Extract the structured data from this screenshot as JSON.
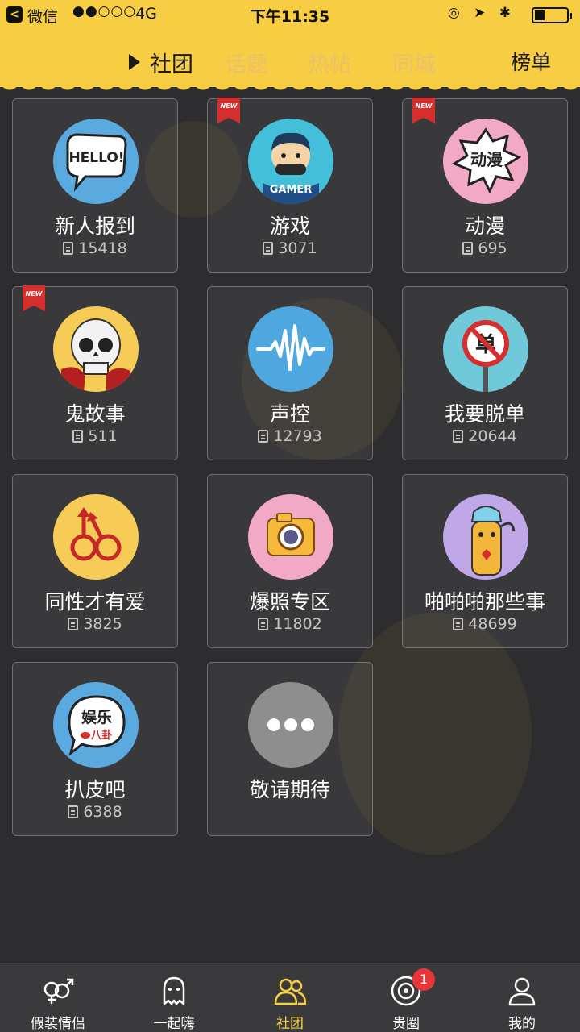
{
  "status_bar": {
    "back_label": "<",
    "carrier": "微信",
    "signal": "●●○○○",
    "network": "4G",
    "time": "下午11:35",
    "right_icons": "◎ ➤ ✱"
  },
  "header": {
    "tabs": [
      {
        "label": "社团",
        "active": true
      },
      {
        "label": "话题",
        "active": false
      },
      {
        "label": "热帖",
        "active": false
      },
      {
        "label": "同城",
        "active": false
      }
    ],
    "rank_label": "榜单"
  },
  "clubs": [
    {
      "name": "新人报到",
      "count": "15418",
      "is_new": false,
      "icon": "hello-speech-bubble-icon",
      "bg": "#5aa9df"
    },
    {
      "name": "游戏",
      "count": "3071",
      "is_new": true,
      "new_label": "NEW",
      "icon": "gamer-controller-icon",
      "bg": "#44bfd9"
    },
    {
      "name": "动漫",
      "count": "695",
      "is_new": true,
      "new_label": "NEW",
      "icon": "comic-burst-icon",
      "bg": "#f2a9c6"
    },
    {
      "name": "鬼故事",
      "count": "511",
      "is_new": true,
      "new_label": "NEW",
      "icon": "skull-icon",
      "bg": "#f6cc56"
    },
    {
      "name": "声控",
      "count": "12793",
      "is_new": false,
      "icon": "sound-wave-icon",
      "bg": "#4fa7df"
    },
    {
      "name": "我要脱单",
      "count": "20644",
      "is_new": false,
      "icon": "no-single-sign-icon",
      "bg": "#6fc9d8"
    },
    {
      "name": "同性才有爱",
      "count": "3825",
      "is_new": false,
      "icon": "male-symbols-icon",
      "bg": "#f6cc56"
    },
    {
      "name": "爆照专区",
      "count": "11802",
      "is_new": false,
      "icon": "camera-icon",
      "bg": "#f2a9c6"
    },
    {
      "name": "啪啪啪那些事",
      "count": "48699",
      "is_new": false,
      "icon": "cartoon-character-icon",
      "bg": "#c0a8e8"
    },
    {
      "name": "扒皮吧",
      "count": "6388",
      "is_new": false,
      "icon": "gossip-bubble-icon",
      "bg": "#5aa9df"
    },
    {
      "name": "敬请期待",
      "count": "",
      "is_new": false,
      "icon": "more-dots-icon",
      "bg": "#8e8e8e"
    }
  ],
  "club_art_text": {
    "hello": "HELLO!",
    "gamer": "GAMER",
    "comic": "动漫",
    "no_single": "单",
    "gossip_main": "娱乐",
    "gossip_sub": "八卦"
  },
  "tabbar": {
    "items": [
      {
        "label": "假装情侣",
        "icon": "gender-couple-icon",
        "active": false
      },
      {
        "label": "一起嗨",
        "icon": "ghost-icon",
        "active": false
      },
      {
        "label": "社团",
        "icon": "group-people-icon",
        "active": true
      },
      {
        "label": "贵圈",
        "icon": "circle-target-icon",
        "active": false,
        "badge": "1"
      },
      {
        "label": "我的",
        "icon": "person-icon",
        "active": false
      }
    ]
  },
  "colors": {
    "accent_yellow": "#f7cd44",
    "background": "#2d2d2f",
    "badge_red": "#e8353a"
  }
}
